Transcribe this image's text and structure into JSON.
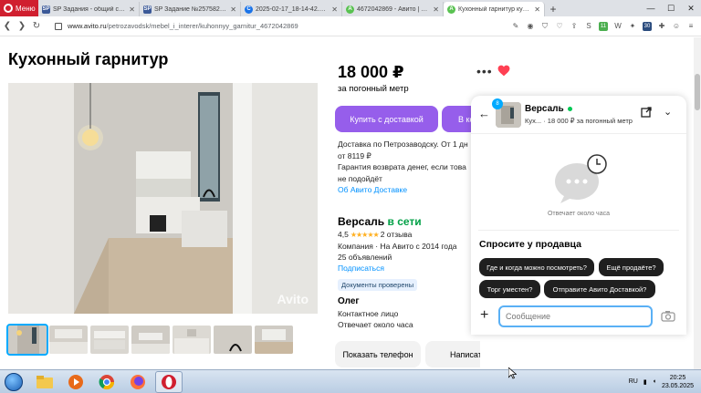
{
  "browser": {
    "menu_label": "Меню",
    "tabs": [
      {
        "favicon": "SP",
        "favicon_color": "#e8eef8",
        "title": "SP Задания - общий список ·",
        "active": false
      },
      {
        "favicon": "SP",
        "favicon_color": "#e8eef8",
        "title": "SP Задание №2575826 - про",
        "active": false
      },
      {
        "favicon": "C",
        "favicon_color": "#1a73e8",
        "title": "2025-02-17_18-14-42.png",
        "active": false
      },
      {
        "favicon": "A",
        "favicon_color": "#59c251",
        "title": "4672042869 - Авито | Объ",
        "active": false
      },
      {
        "favicon": "A",
        "favicon_color": "#59c251",
        "title": "Кухонный гарнитур купить",
        "active": true
      }
    ],
    "new_tab": "+",
    "url_host": "www.avito.ru",
    "url_path": "/petrozavodsk/mebel_i_interer/kuhonnyy_garnitur_4672042869",
    "ext_badge_1": "11",
    "ext_badge_2": "30"
  },
  "listing": {
    "title": "Кухонный гарнитур",
    "watermark": "Avito",
    "price": "18 000 ₽",
    "price_unit": "за погонный метр",
    "buy_button": "Купить с доставкой",
    "cart_button": "В корзину",
    "delivery_line1": "Доставка по Петрозаводску. От 1 дн",
    "delivery_line2": "от 8119 ₽",
    "delivery_line3": "Гарантия возврата денег, если това",
    "delivery_line4": "не подойдёт",
    "delivery_link": "Об Авито Доставке"
  },
  "seller": {
    "name": "Версаль",
    "online": "в сети",
    "rating": "4,5",
    "stars": "★★★★★",
    "reviews": "2 отзыва",
    "company": "Компания · На Авито с 2014 года",
    "ads": "25 объявлений",
    "subscribe": "Подписаться",
    "docs_badge": "Документы проверены",
    "contact_name": "Олег",
    "contact_role": "Контактное лицо",
    "response": "Отвечает около часа",
    "phone_button": "Показать телефон",
    "write_button": "Написать"
  },
  "chat": {
    "unread_badge": "8",
    "seller": "Версаль",
    "item_preview": "Кух... · 18 000 ₽ за погонный метр",
    "response_note": "Отвечает около часа",
    "ask_title": "Спросите у продавца",
    "questions": [
      "Где и когда можно посмотреть?",
      "Ещё продаёте?",
      "Торг уместен?",
      "Отправите Авито Доставкой?"
    ],
    "message_placeholder": "Сообщение"
  },
  "taskbar": {
    "lang": "RU",
    "time": "20:25",
    "date": "23.05.2025"
  },
  "colors": {
    "accent": "#965eeb",
    "link": "#0091ff",
    "online": "#00a046",
    "heart": "#ff4053",
    "opera": "#d01f2f"
  }
}
